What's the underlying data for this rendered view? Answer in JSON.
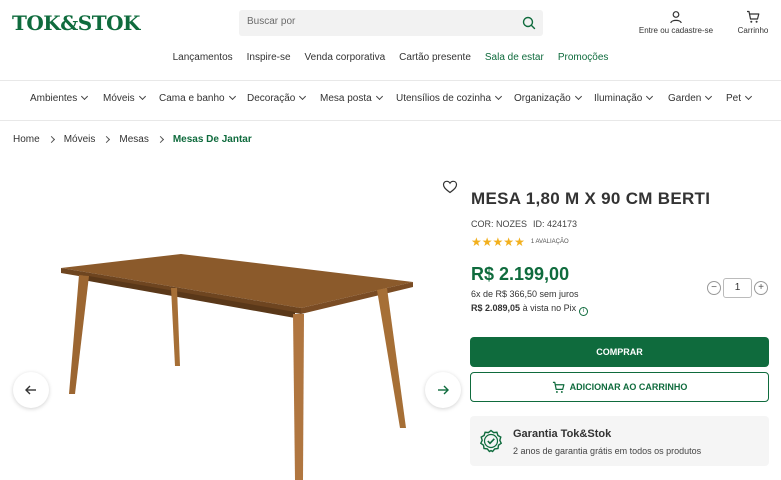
{
  "header": {
    "logo": "TOK&STOK",
    "search_placeholder": "Buscar por",
    "user_label": "Entre ou cadastre-se",
    "cart_label": "Carrinho"
  },
  "top_links": [
    "Lançamentos",
    "Inspire-se",
    "Venda corporativa",
    "Cartão presente",
    "Sala de estar",
    "Promoções"
  ],
  "categories": [
    "Ambientes",
    "Móveis",
    "Cama e banho",
    "Decoração",
    "Mesa posta",
    "Utensílios de cozinha",
    "Organização",
    "Iluminação",
    "Garden",
    "Pet"
  ],
  "breadcrumb": [
    "Home",
    "Móveis",
    "Mesas",
    "Mesas De Jantar"
  ],
  "product": {
    "title": "MESA 1,80 M X 90 CM BERTI",
    "color": "COR: NOZES",
    "id": "ID: 424173",
    "rating": 5,
    "reviews": "1 AVALIAÇÃO",
    "price": "R$ 2.199,00",
    "installments": "6x de R$ 366,50 sem juros",
    "pix_price": "R$ 2.089,05",
    "pix_suffix": "à vista no Pix",
    "quantity": "1",
    "buy_label": "COMPRAR",
    "add_cart_label": "ADICIONAR AO CARRINHO"
  },
  "guarantee": {
    "title": "Garantia Tok&Stok",
    "text": "2 anos de garantia grátis em todos os produtos"
  },
  "colors": {
    "brand_green": "#0f6b3d",
    "star": "#f2b01e",
    "wood": "#8b5a2b"
  }
}
